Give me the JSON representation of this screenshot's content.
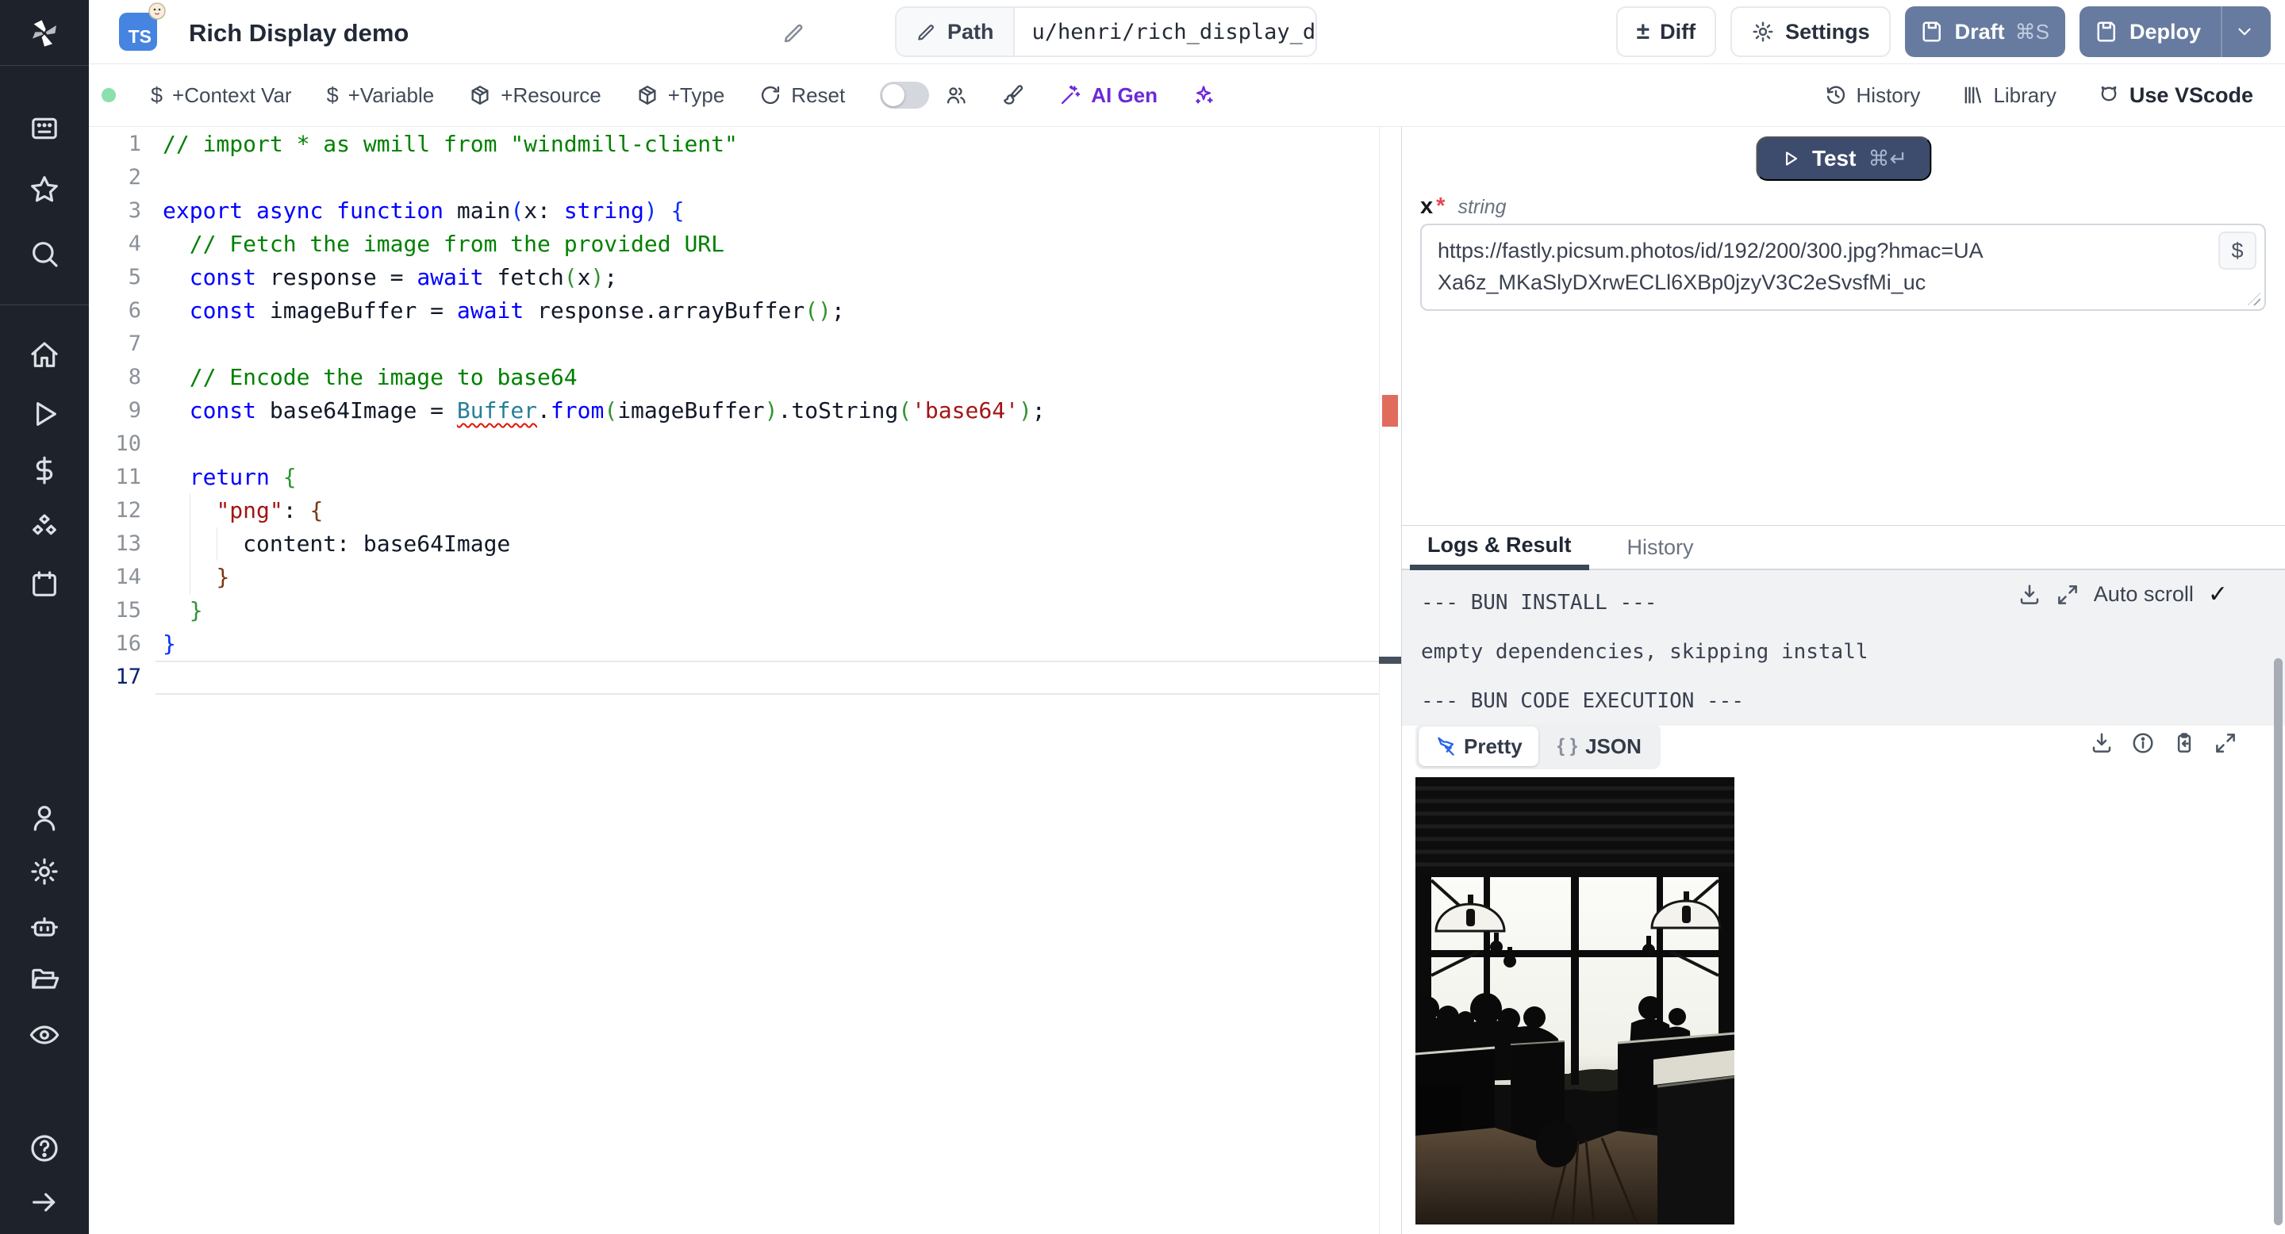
{
  "header": {
    "title": "Rich Display demo",
    "ts_badge": "TS",
    "path_label": "Path",
    "path_value": "u/henri/rich_display_demo",
    "diff_label": "Diff",
    "diff_glyph": "±",
    "settings_label": "Settings",
    "draft_label": "Draft",
    "draft_shortcut": "⌘S",
    "deploy_label": "Deploy"
  },
  "toolbar": {
    "dollar": "$",
    "context_var": "+Context Var",
    "variable": "+Variable",
    "resource": "+Resource",
    "type": "+Type",
    "reset": "Reset",
    "ai_gen": "AI Gen",
    "history": "History",
    "library": "Library",
    "use_vscode": "Use VScode"
  },
  "sidebar": {
    "icons": [
      "windmill-logo",
      "apps",
      "star",
      "search",
      "home",
      "play",
      "dollar",
      "boxes",
      "calendar",
      "user",
      "settings",
      "robot",
      "folder-open",
      "eye",
      "help",
      "arrow-right"
    ]
  },
  "editor": {
    "lines": [
      {
        "n": 1,
        "seg": [
          {
            "t": "// import * as wmill from \"windmill-client\"",
            "c": "cm"
          }
        ]
      },
      {
        "n": 2,
        "seg": []
      },
      {
        "n": 3,
        "seg": [
          {
            "t": "export",
            "c": "kw"
          },
          {
            "t": " ",
            "c": "tx"
          },
          {
            "t": "async",
            "c": "kw"
          },
          {
            "t": " ",
            "c": "tx"
          },
          {
            "t": "function",
            "c": "kw"
          },
          {
            "t": " main",
            "c": "tx"
          },
          {
            "t": "(",
            "c": "b1"
          },
          {
            "t": "x: ",
            "c": "tx"
          },
          {
            "t": "string",
            "c": "kw"
          },
          {
            "t": ")",
            "c": "b1"
          },
          {
            "t": " ",
            "c": "tx"
          },
          {
            "t": "{",
            "c": "b1"
          }
        ]
      },
      {
        "n": 4,
        "seg": [
          {
            "t": "  ",
            "c": "tx"
          },
          {
            "t": "// Fetch the image from the provided URL",
            "c": "cm"
          }
        ]
      },
      {
        "n": 5,
        "seg": [
          {
            "t": "  ",
            "c": "tx"
          },
          {
            "t": "const",
            "c": "kw"
          },
          {
            "t": " response = ",
            "c": "tx"
          },
          {
            "t": "await",
            "c": "kw"
          },
          {
            "t": " fetch",
            "c": "tx"
          },
          {
            "t": "(",
            "c": "b2"
          },
          {
            "t": "x",
            "c": "tx"
          },
          {
            "t": ")",
            "c": "b2"
          },
          {
            "t": ";",
            "c": "tx"
          }
        ]
      },
      {
        "n": 6,
        "seg": [
          {
            "t": "  ",
            "c": "tx"
          },
          {
            "t": "const",
            "c": "kw"
          },
          {
            "t": " imageBuffer = ",
            "c": "tx"
          },
          {
            "t": "await",
            "c": "kw"
          },
          {
            "t": " response.arrayBuffer",
            "c": "tx"
          },
          {
            "t": "()",
            "c": "b2"
          },
          {
            "t": ";",
            "c": "tx"
          }
        ]
      },
      {
        "n": 7,
        "seg": []
      },
      {
        "n": 8,
        "seg": [
          {
            "t": "  ",
            "c": "tx"
          },
          {
            "t": "// Encode the image to base64",
            "c": "cm"
          }
        ]
      },
      {
        "n": 9,
        "seg": [
          {
            "t": "  ",
            "c": "tx"
          },
          {
            "t": "const",
            "c": "kw"
          },
          {
            "t": " base64Image = ",
            "c": "tx"
          },
          {
            "t": "Buffer",
            "c": "er"
          },
          {
            "t": ".",
            "c": "tx"
          },
          {
            "t": "from",
            "c": "kw"
          },
          {
            "t": "(",
            "c": "b2"
          },
          {
            "t": "imageBuffer",
            "c": "tx"
          },
          {
            "t": ")",
            "c": "b2"
          },
          {
            "t": ".toString",
            "c": "tx"
          },
          {
            "t": "(",
            "c": "b2"
          },
          {
            "t": "'base64'",
            "c": "st"
          },
          {
            "t": ")",
            "c": "b2"
          },
          {
            "t": ";",
            "c": "tx"
          }
        ]
      },
      {
        "n": 10,
        "seg": []
      },
      {
        "n": 11,
        "seg": [
          {
            "t": "  ",
            "c": "tx"
          },
          {
            "t": "return",
            "c": "kw"
          },
          {
            "t": " ",
            "c": "tx"
          },
          {
            "t": "{",
            "c": "b2"
          }
        ]
      },
      {
        "n": 12,
        "seg": [
          {
            "t": "    ",
            "c": "tx"
          },
          {
            "t": "\"png\"",
            "c": "st"
          },
          {
            "t": ": ",
            "c": "tx"
          },
          {
            "t": "{",
            "c": "b3"
          }
        ]
      },
      {
        "n": 13,
        "seg": [
          {
            "t": "      content: base64Image",
            "c": "tx"
          }
        ]
      },
      {
        "n": 14,
        "seg": [
          {
            "t": "    ",
            "c": "tx"
          },
          {
            "t": "}",
            "c": "b3"
          }
        ]
      },
      {
        "n": 15,
        "seg": [
          {
            "t": "  ",
            "c": "tx"
          },
          {
            "t": "}",
            "c": "b2"
          }
        ]
      },
      {
        "n": 16,
        "seg": [
          {
            "t": "}",
            "c": "b1"
          }
        ]
      },
      {
        "n": 17,
        "seg": [],
        "active": true
      }
    ]
  },
  "run": {
    "test_label": "Test",
    "test_shortcut": "⌘↵",
    "arg_name": "x",
    "required_mark": "*",
    "arg_type": "string",
    "value": "https://fastly.picsum.photos/id/192/200/300.jpg?hmac=UAXa6z_MKaSlyDXrwECLl6XBp0jzyV3C2eSvsfMi_uc",
    "dollar": "$"
  },
  "logs": {
    "tab_active": "Logs & Result",
    "tab_history": "History",
    "auto_scroll": "Auto scroll",
    "check": "✓",
    "lines": [
      "--- BUN INSTALL ---",
      "empty dependencies, skipping install",
      "--- BUN CODE EXECUTION ---"
    ]
  },
  "result": {
    "pretty": "Pretty",
    "braces": "{ }",
    "json": "JSON"
  },
  "colors": {
    "sidebar_bg": "#1e222a",
    "primary_button": "#677ba0",
    "test_button": "#3d4c6c",
    "ai_accent": "#6d28d9",
    "green_status": "#8be0ae",
    "error_marker": "#e06c5d",
    "log_bg": "#f1f2f4"
  }
}
